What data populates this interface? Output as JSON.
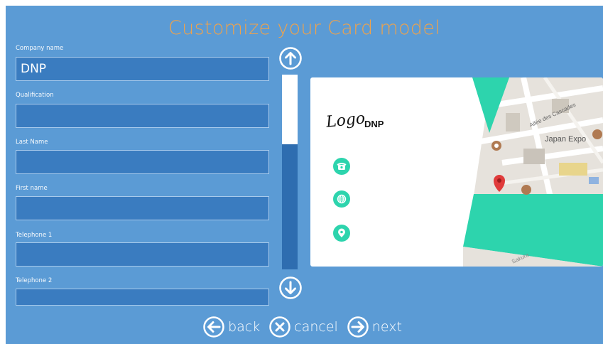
{
  "title": "Customize your Card model",
  "form": {
    "fields": [
      {
        "label": "Company name",
        "value": "DNP"
      },
      {
        "label": "Qualification",
        "value": ""
      },
      {
        "label": "Last Name",
        "value": ""
      },
      {
        "label": "First name",
        "value": ""
      },
      {
        "label": "Telephone 1",
        "value": ""
      },
      {
        "label": "Telephone 2",
        "value": ""
      }
    ]
  },
  "card": {
    "logo_text": "Logo",
    "company_text": "DNP",
    "map_labels": {
      "street": "Allée des Cascades",
      "place": "Japan Expo",
      "street2": "Sakura"
    },
    "accent_color": "#2dd4ad"
  },
  "nav": {
    "back_label": "back",
    "cancel_label": "cancel",
    "next_label": "next"
  },
  "colors": {
    "background": "#5b9bd5",
    "input": "#3a7cc0",
    "title": "#f0a24a"
  }
}
